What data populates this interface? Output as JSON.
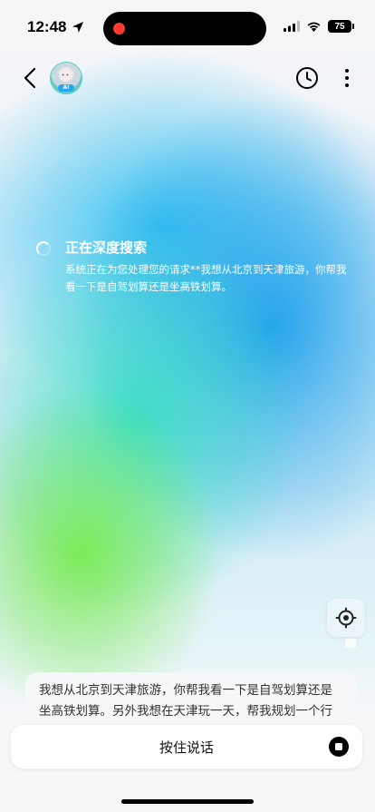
{
  "status_bar": {
    "time": "12:48",
    "battery": "75"
  },
  "nav": {
    "avatar_badge": "AI"
  },
  "search": {
    "title": "正在深度搜索",
    "description": "系统正在为您处理您的请求**我想从北京到天津旅游，你帮我看一下是自驾划算还是坐高铁划算。"
  },
  "message": {
    "text": "我想从北京到天津旅游，你帮我看一下是自驾划算还是坐高铁划算。另外我想在天津玩一天，帮我规划一个行程。"
  },
  "input": {
    "talk_label": "按住说话"
  },
  "icons": {
    "back": "chevron-left-icon",
    "history": "clock-icon",
    "more": "more-vertical-icon",
    "locate": "crosshair-icon",
    "stop": "stop-icon"
  }
}
